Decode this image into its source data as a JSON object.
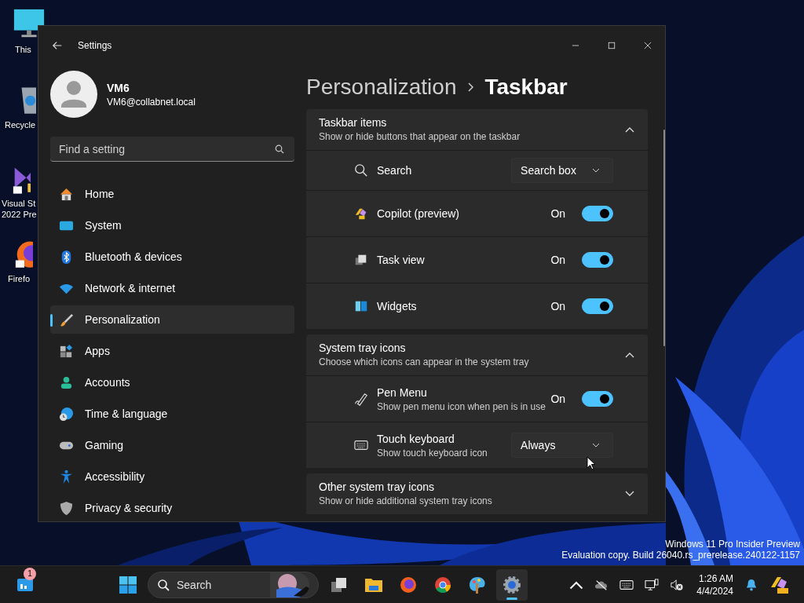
{
  "desktop_icons": [
    {
      "kind": "pc",
      "lines": [
        "This"
      ]
    },
    {
      "kind": "recycle",
      "lines": [
        "Recycle"
      ]
    },
    {
      "kind": "vs",
      "lines": [
        "Visual St",
        "2022 Pre"
      ]
    },
    {
      "kind": "firefox",
      "lines": [
        "Firefo"
      ]
    }
  ],
  "watermark": [
    "Windows 11 Pro Insider Preview",
    "Evaluation copy. Build 26040.rs_prerelease.240122-1157"
  ],
  "window": {
    "title": "Settings"
  },
  "profile": {
    "name": "VM6",
    "email": "VM6@collabnet.local"
  },
  "search": {
    "placeholder": "Find a setting"
  },
  "nav": [
    {
      "label": "Home",
      "selected": false
    },
    {
      "label": "System",
      "selected": false
    },
    {
      "label": "Bluetooth & devices",
      "selected": false
    },
    {
      "label": "Network & internet",
      "selected": false
    },
    {
      "label": "Personalization",
      "selected": true
    },
    {
      "label": "Apps",
      "selected": false
    },
    {
      "label": "Accounts",
      "selected": false
    },
    {
      "label": "Time & language",
      "selected": false
    },
    {
      "label": "Gaming",
      "selected": false
    },
    {
      "label": "Accessibility",
      "selected": false
    },
    {
      "label": "Privacy & security",
      "selected": false
    }
  ],
  "breadcrumb": {
    "parent": "Personalization",
    "current": "Taskbar"
  },
  "sections": [
    {
      "title": "Taskbar items",
      "subtitle": "Show or hide buttons that appear on the taskbar",
      "expanded": true,
      "rows": [
        {
          "kind": "dropdown",
          "label": "Search",
          "value": "Search box"
        },
        {
          "kind": "toggle",
          "label": "Copilot (preview)",
          "state_text": "On",
          "on": true
        },
        {
          "kind": "toggle",
          "label": "Task view",
          "state_text": "On",
          "on": true
        },
        {
          "kind": "toggle",
          "label": "Widgets",
          "state_text": "On",
          "on": true
        }
      ]
    },
    {
      "title": "System tray icons",
      "subtitle": "Choose which icons can appear in the system tray",
      "expanded": true,
      "rows": [
        {
          "kind": "toggle",
          "label": "Pen Menu",
          "description": "Show pen menu icon when pen is in use",
          "state_text": "On",
          "on": true
        },
        {
          "kind": "dropdown",
          "label": "Touch keyboard",
          "description": "Show touch keyboard icon",
          "value": "Always"
        }
      ]
    },
    {
      "title": "Other system tray icons",
      "subtitle": "Show or hide additional system tray icons",
      "expanded": false
    }
  ],
  "taskbar": {
    "widget_badge": "1",
    "search_placeholder": "Search",
    "apps": [
      {
        "kind": "taskview",
        "active": false
      },
      {
        "kind": "explorer",
        "active": false
      },
      {
        "kind": "firefox",
        "active": false
      },
      {
        "kind": "chrome",
        "active": false
      },
      {
        "kind": "paint",
        "active": false
      },
      {
        "kind": "settings",
        "active": true
      }
    ],
    "time": "1:26 AM",
    "date": "4/4/2024"
  }
}
